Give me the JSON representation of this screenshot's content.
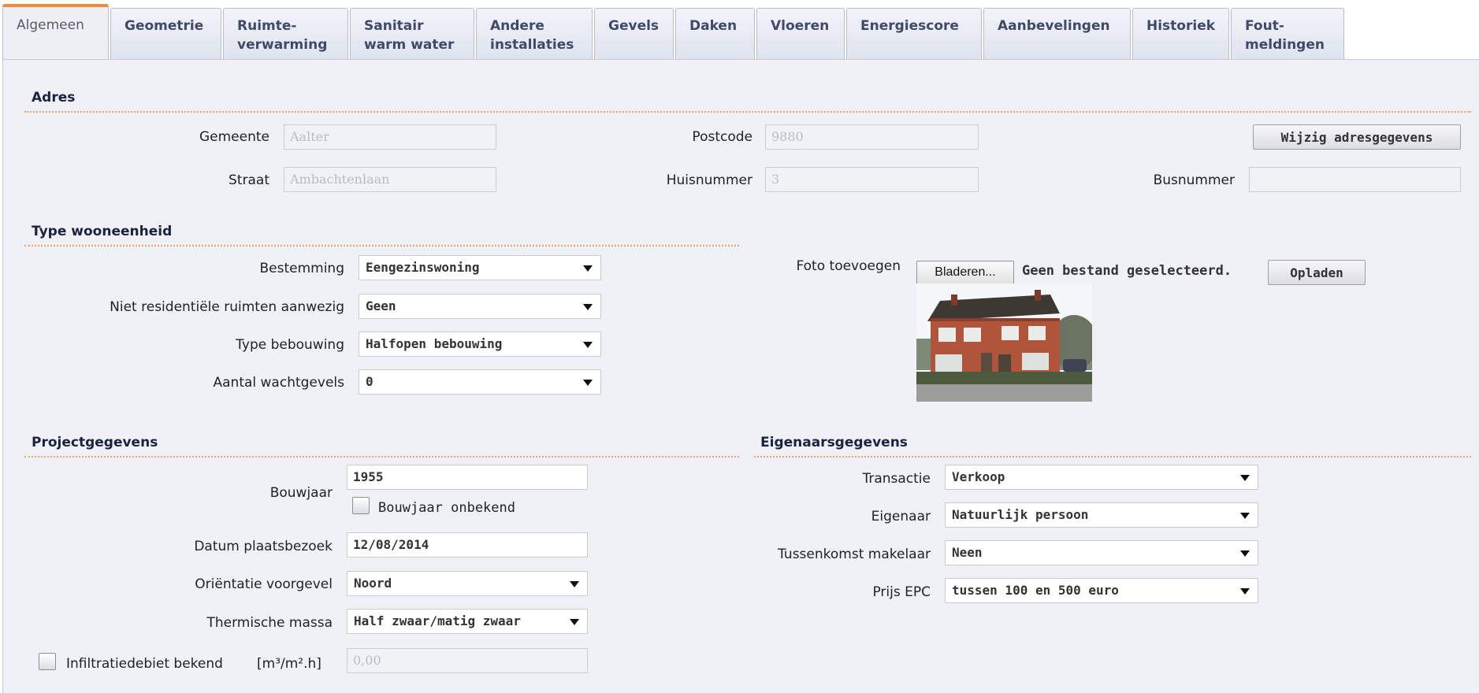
{
  "tabs": [
    {
      "label": "Algemeen",
      "active": true
    },
    {
      "label": "Geometrie"
    },
    {
      "label": "Ruimte-\nverwarming"
    },
    {
      "label": "Sanitair\nwarm water"
    },
    {
      "label": "Andere\ninstallaties"
    },
    {
      "label": "Gevels"
    },
    {
      "label": "Daken"
    },
    {
      "label": "Vloeren"
    },
    {
      "label": "Energiescore"
    },
    {
      "label": "Aanbevelingen"
    },
    {
      "label": "Historiek"
    },
    {
      "label": "Fout-\nmeldingen"
    }
  ],
  "adres": {
    "title": "Adres",
    "gemeente_label": "Gemeente",
    "gemeente_value": "Aalter",
    "postcode_label": "Postcode",
    "postcode_value": "9880",
    "wijzig_button": "Wijzig adresgegevens",
    "straat_label": "Straat",
    "straat_value": "Ambachtenlaan",
    "huisnummer_label": "Huisnummer",
    "huisnummer_value": "3",
    "busnummer_label": "Busnummer",
    "busnummer_value": ""
  },
  "type_wooneenheid": {
    "title": "Type wooneenheid",
    "bestemming_label": "Bestemming",
    "bestemming_value": "Eengezinswoning",
    "niet_res_label": "Niet residentiële ruimten aanwezig",
    "niet_res_value": "Geen",
    "type_bebouwing_label": "Type bebouwing",
    "type_bebouwing_value": "Halfopen bebouwing",
    "wachtgevels_label": "Aantal wachtgevels",
    "wachtgevels_value": "0"
  },
  "foto": {
    "label": "Foto toevoegen",
    "browse_button": "Bladeren...",
    "status": "Geen bestand geselecteerd.",
    "upload_button": "Opladen"
  },
  "project": {
    "title": "Projectgegevens",
    "bouwjaar_label": "Bouwjaar",
    "bouwjaar_value": "1955",
    "bouwjaar_onbekend_label": "Bouwjaar onbekend",
    "datum_label": "Datum plaatsbezoek",
    "datum_value": "12/08/2014",
    "orientatie_label": "Oriëntatie voorgevel",
    "orientatie_value": "Noord",
    "thermische_label": "Thermische massa",
    "thermische_value": "Half zwaar/matig zwaar",
    "infiltratie_label": "Infiltratiedebiet bekend",
    "infiltratie_unit": "[m³/m².h]",
    "infiltratie_value": "0,00"
  },
  "eigenaar": {
    "title": "Eigenaarsgegevens",
    "transactie_label": "Transactie",
    "transactie_value": "Verkoop",
    "eigenaar_label": "Eigenaar",
    "eigenaar_value": "Natuurlijk persoon",
    "makelaar_label": "Tussenkomst makelaar",
    "makelaar_value": "Neen",
    "prijs_label": "Prijs EPC",
    "prijs_value": "tussen 100 en 500 euro"
  },
  "colors": {
    "accent": "#f08a3c",
    "panel": "#eff1f7",
    "tab_text": "#404a68"
  }
}
